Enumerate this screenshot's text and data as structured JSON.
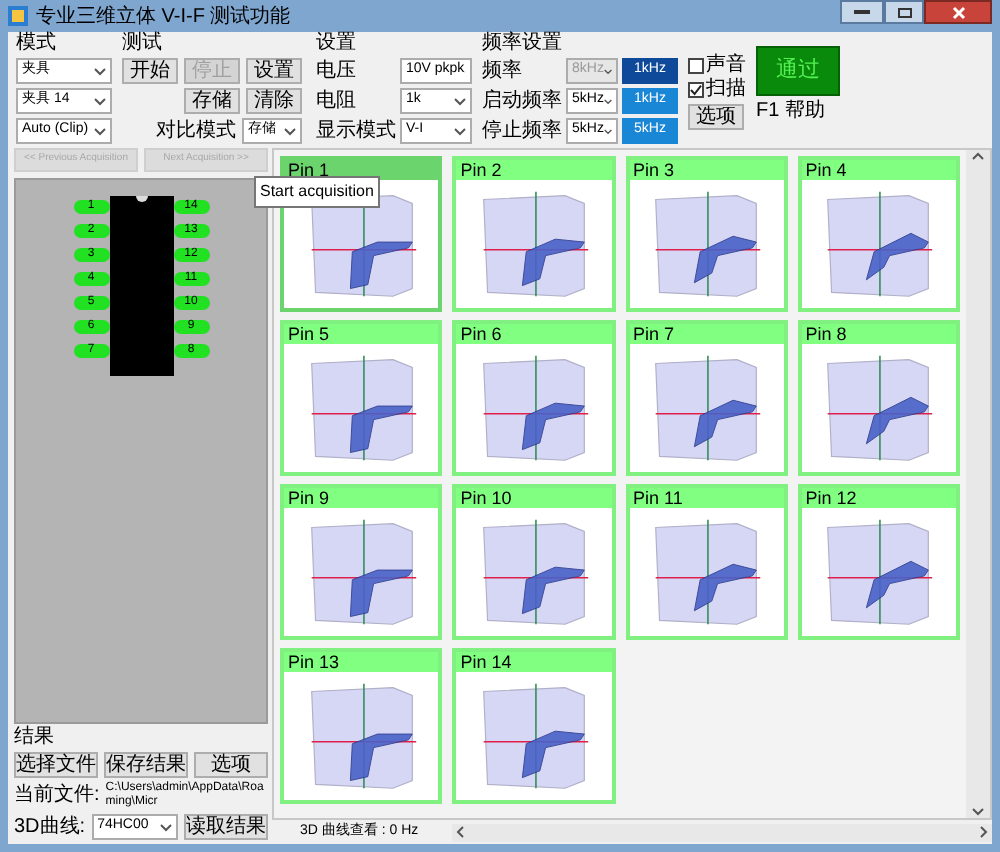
{
  "window": {
    "title": "专业三维立体 V-I-F 测试功能"
  },
  "mode": {
    "label": "模式",
    "dropdowns": [
      "夹具",
      "夹具 14",
      "Auto (Clip)"
    ]
  },
  "test": {
    "label": "测试",
    "buttons": [
      {
        "label": "开始",
        "disabled": false
      },
      {
        "label": "停止",
        "disabled": true
      },
      {
        "label": "设置",
        "disabled": false
      },
      {
        "label": "存储",
        "disabled": false
      },
      {
        "label": "清除",
        "disabled": false
      }
    ],
    "compare_label": "对比模式",
    "compare_value": "存储"
  },
  "settings": {
    "label": "设置",
    "rows": [
      {
        "label": "电压",
        "value": "10V pkpk"
      },
      {
        "label": "电阻",
        "value": "1k"
      },
      {
        "label": "显示模式",
        "value": "V-I"
      }
    ]
  },
  "frequency": {
    "label": "频率设置",
    "rows": [
      {
        "label": "频率",
        "value": "8kHz",
        "disabled": true,
        "reading": "1kHz",
        "selected": true
      },
      {
        "label": "启动频率",
        "value": "5kHz",
        "disabled": false,
        "reading": "1kHz",
        "selected": false
      },
      {
        "label": "停止频率",
        "value": "5kHz",
        "disabled": false,
        "reading": "5kHz",
        "selected": false
      }
    ]
  },
  "checkboxes": [
    {
      "label": "声音",
      "checked": false
    },
    {
      "label": "扫描",
      "checked": true
    }
  ],
  "options_button": "选项",
  "status": {
    "label": "通过",
    "passed": true
  },
  "help": "F1 帮助",
  "navigation": [
    {
      "label": "<< Previous Acquisition",
      "disabled": true
    },
    {
      "label": "Next Acquisition >>",
      "disabled": true
    }
  ],
  "tooltip": "Start acquisition",
  "chip": {
    "left_pins": [
      "1",
      "2",
      "3",
      "4",
      "5",
      "6",
      "7"
    ],
    "right_pins": [
      "14",
      "13",
      "12",
      "11",
      "10",
      "9",
      "8"
    ]
  },
  "results": {
    "label": "结果",
    "buttons": [
      "选择文件",
      "保存结果",
      "选项"
    ],
    "file_label": "当前文件:",
    "file_path": "C:\\Users\\admin\\AppData\\Roaming\\Micr",
    "curve_label": "3D曲线:",
    "curve_value": "74HC00",
    "load_button": "读取结果"
  },
  "pins": [
    {
      "label": "Pin 1",
      "selected": true
    },
    {
      "label": "Pin 2",
      "selected": false
    },
    {
      "label": "Pin 3",
      "selected": false
    },
    {
      "label": "Pin 4",
      "selected": false
    },
    {
      "label": "Pin 5",
      "selected": false
    },
    {
      "label": "Pin 6",
      "selected": false
    },
    {
      "label": "Pin 7",
      "selected": false
    },
    {
      "label": "Pin 8",
      "selected": false
    },
    {
      "label": "Pin 9",
      "selected": false
    },
    {
      "label": "Pin 10",
      "selected": false
    },
    {
      "label": "Pin 11",
      "selected": false
    },
    {
      "label": "Pin 12",
      "selected": false
    },
    {
      "label": "Pin 13",
      "selected": false
    },
    {
      "label": "Pin 14",
      "selected": false
    }
  ],
  "status_bar": {
    "text": "3D 曲线查看 : 0 Hz"
  }
}
